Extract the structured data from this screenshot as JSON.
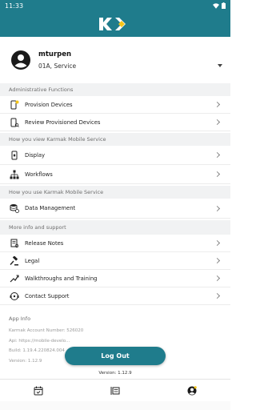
{
  "status": {
    "time": "11:33"
  },
  "user": {
    "name": "mturpen",
    "service": "01A, Service"
  },
  "sections": [
    {
      "header": "Administrative Functions",
      "items": [
        {
          "label": "Provision Devices",
          "icon": "provision-device-icon"
        },
        {
          "label": "Review Provisioned Devices",
          "icon": "review-devices-icon"
        }
      ]
    },
    {
      "header": "How you view Karmak Mobile Service",
      "items": [
        {
          "label": "Display",
          "icon": "display-icon"
        },
        {
          "label": "Workflows",
          "icon": "workflows-icon"
        }
      ]
    },
    {
      "header": "How you use Karmak Mobile Service",
      "items": [
        {
          "label": "Data Management",
          "icon": "data-management-icon"
        }
      ]
    },
    {
      "header": "More info and support",
      "items": [
        {
          "label": "Release Notes",
          "icon": "release-notes-icon"
        },
        {
          "label": "Legal",
          "icon": "gavel-icon"
        },
        {
          "label": "Walkthroughs and Training",
          "icon": "training-icon"
        },
        {
          "label": "Contact Support",
          "icon": "support-icon"
        }
      ]
    }
  ],
  "app_info": {
    "header": "App Info",
    "lines": [
      "Karmak Account Number: 526020",
      "Api: https://mobile-develo...",
      "Build: 1.19.4.220824.004",
      "Version: 1.12.9"
    ]
  },
  "logout_label": "Log Out",
  "version_label": "Version: 1.12.9",
  "colors": {
    "primary": "#1f7c8c",
    "accent": "#f5c518",
    "section_bg": "#f1f2f3"
  }
}
